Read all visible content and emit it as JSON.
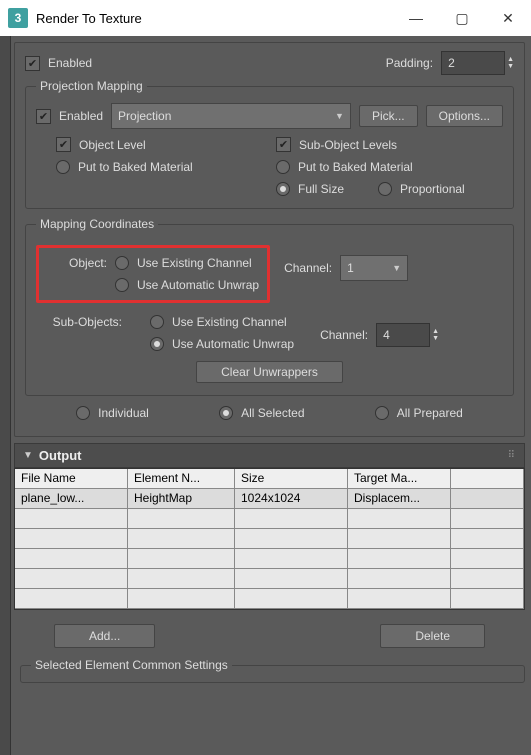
{
  "window": {
    "title": "Render To Texture"
  },
  "top": {
    "enabled_label": "Enabled",
    "padding_label": "Padding:",
    "padding_value": "2"
  },
  "proj": {
    "title": "Projection Mapping",
    "enabled_label": "Enabled",
    "dropdown_value": "Projection",
    "pick_btn": "Pick...",
    "options_btn": "Options...",
    "object_level": "Object Level",
    "sub_object_levels": "Sub-Object Levels",
    "put_to_baked_left": "Put to Baked Material",
    "put_to_baked_right": "Put to Baked Material",
    "full_size": "Full Size",
    "proportional": "Proportional"
  },
  "mapcoord": {
    "title": "Mapping Coordinates",
    "object_label": "Object:",
    "use_existing": "Use Existing Channel",
    "use_auto": "Use Automatic Unwrap",
    "channel_label": "Channel:",
    "channel1": "1",
    "subobj_label": "Sub-Objects:",
    "channel4": "4",
    "clear_btn": "Clear Unwrappers",
    "individual": "Individual",
    "all_selected": "All Selected",
    "all_prepared": "All Prepared"
  },
  "output": {
    "title": "Output",
    "headers": {
      "file": "File Name",
      "elem": "Element N...",
      "size": "Size",
      "target": "Target Ma..."
    },
    "row": {
      "file": "plane_low...",
      "elem": "HeightMap",
      "size": "1024x1024",
      "target": "Displacem..."
    },
    "add_btn": "Add...",
    "delete_btn": "Delete"
  },
  "footer": {
    "title": "Selected Element Common Settings"
  }
}
